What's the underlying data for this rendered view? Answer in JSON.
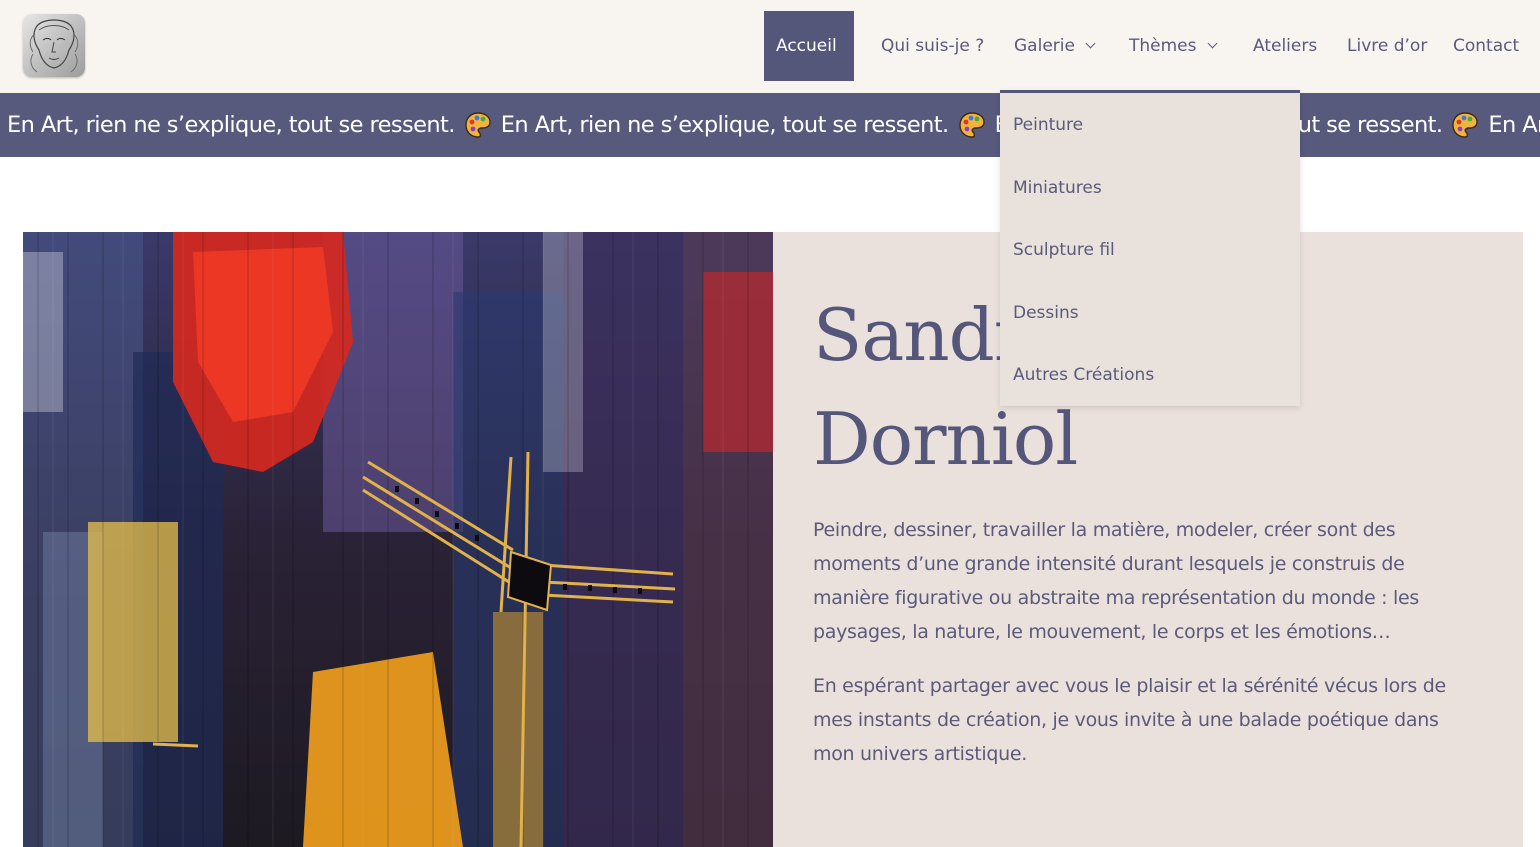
{
  "header": {
    "nav": [
      {
        "label": "Accueil",
        "active": true
      },
      {
        "label": "Qui suis-je ?"
      },
      {
        "label": "Galerie",
        "has_dropdown": true
      },
      {
        "label": "Thèmes",
        "has_dropdown": true
      },
      {
        "label": "Ateliers"
      },
      {
        "label": "Livre d’or"
      },
      {
        "label": "Contact"
      }
    ]
  },
  "marquee": {
    "text": "En Art, rien ne s’explique, tout se ressent.",
    "icon": "artist-palette-icon"
  },
  "dropdown": {
    "items": [
      "Peinture",
      "Miniatures",
      "Sculpture fil",
      "Dessins",
      "Autres Créations"
    ]
  },
  "hero": {
    "title_line1": "Sandrine –",
    "title_line2": "Dorniol",
    "paragraphs": [
      "Peindre, dessiner, travailler la matière, modeler, créer sont des moments d’une grande intensité durant lesquels je construis de manière figurative ou abstraite ma représentation du monde : les paysages, la nature, le mouvement, le corps et les émotions…",
      "En espérant partager avec vous le plaisir et la sérénité vécus lors de mes instants de création, je vous invite à une balade poétique dans mon univers artistique."
    ]
  },
  "colors": {
    "primary": "#55577a",
    "header_bg": "#f8f5f1",
    "panel_bg": "#eae1dc",
    "dropdown_bg": "#e9e1dc"
  }
}
